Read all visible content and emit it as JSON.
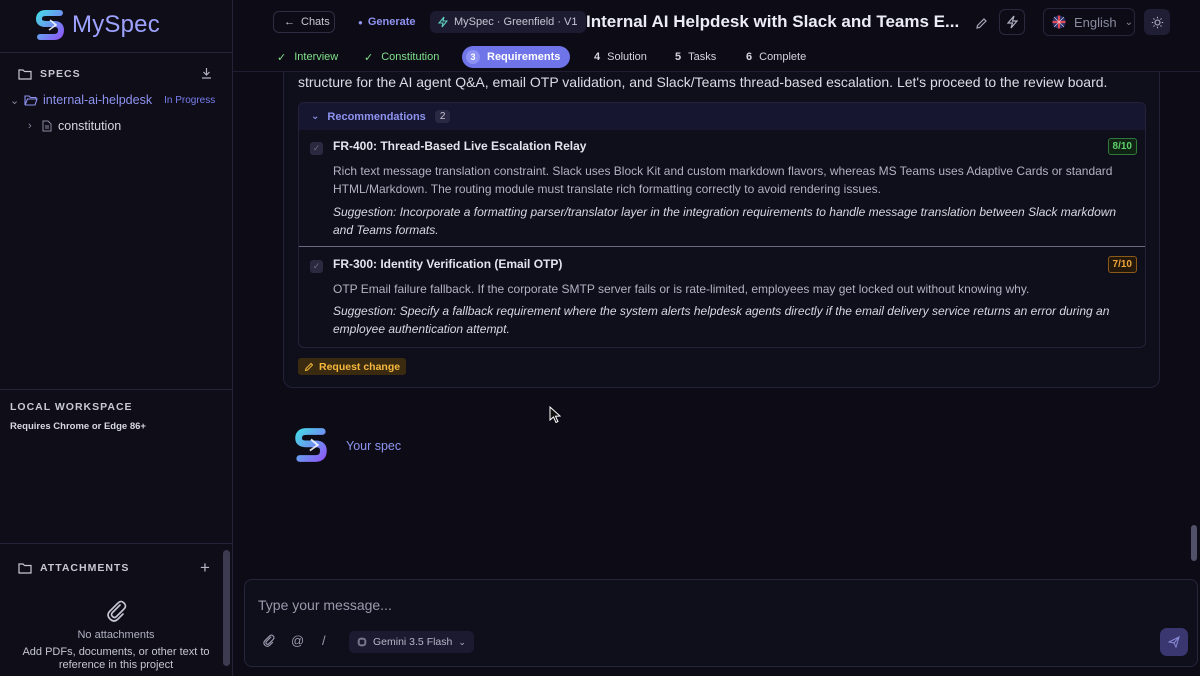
{
  "app": {
    "name": "MySpec"
  },
  "sidebar": {
    "specs_title": "SPECS",
    "tree": [
      {
        "label": "internal-ai-helpdesk",
        "status": "In Progress"
      },
      {
        "label": "constitution"
      }
    ],
    "workspace_title": "LOCAL WORKSPACE",
    "workspace_note": "Requires Chrome or Edge 86+",
    "attachments_title": "ATTACHMENTS",
    "attachments_empty": "No attachments",
    "attachments_hint": "Add PDFs, documents, or other text to reference in this project"
  },
  "header": {
    "back_label": "Chats",
    "generate_label": "Generate",
    "project_badge": "MySpec · Greenfield · V1",
    "title": "Internal AI Helpdesk with Slack and Teams E...",
    "language": "English"
  },
  "steps": [
    {
      "label": "Interview",
      "state": "done"
    },
    {
      "label": "Constitution",
      "state": "done"
    },
    {
      "num": "3",
      "label": "Requirements",
      "state": "active"
    },
    {
      "num": "4",
      "label": "Solution",
      "state": "todo"
    },
    {
      "num": "5",
      "label": "Tasks",
      "state": "todo"
    },
    {
      "num": "6",
      "label": "Complete",
      "state": "todo"
    }
  ],
  "message": {
    "intro": "structure for the AI agent Q&A, email OTP validation, and Slack/Teams thread-based escalation. Let's proceed to the review board.",
    "recommendations_label": "Recommendations",
    "recommendations_count": "2",
    "recommendations": [
      {
        "title": "FR-400: Thread-Based Live Escalation Relay",
        "score": "8/10",
        "description": "Rich text message translation constraint. Slack uses Block Kit and custom markdown flavors, whereas MS Teams uses Adaptive Cards or standard HTML/Markdown. The routing module must translate rich formatting correctly to avoid rendering issues.",
        "suggestion": "Suggestion: Incorporate a formatting parser/translator layer in the integration requirements to handle message translation between Slack markdown and Teams formats."
      },
      {
        "title": "FR-300: Identity Verification (Email OTP)",
        "score": "7/10",
        "description": "OTP Email failure fallback. If the corporate SMTP server fails or is rate-limited, employees may get locked out without knowing why.",
        "suggestion": "Suggestion: Specify a fallback requirement where the system alerts helpdesk agents directly if the email delivery service returns an error during an employee authentication attempt."
      }
    ],
    "request_change_label": "Request change"
  },
  "assistant_label": "Your spec",
  "composer": {
    "placeholder": "Type your message...",
    "model": "Gemini 3.5 Flash",
    "mention_symbol": "@",
    "command_symbol": "/"
  },
  "colors": {
    "accent": "#8e93f0",
    "active_step": "#6f74e8",
    "done": "#7fe08a",
    "score_green": "#5ed16a",
    "score_orange": "#f0a53a",
    "status_in_progress": "#7a7ff0"
  },
  "icons": {
    "logo": "myspec-logo-icon",
    "specs": "folder-icon",
    "download": "download-icon",
    "project": "folder-open-icon",
    "file": "file-icon",
    "attachments": "folder-icon",
    "add": "plus-icon",
    "empty_attachments": "paperclip-icon",
    "edit": "pencil-icon",
    "bolt": "bolt-icon",
    "theme": "sun-icon",
    "send": "send-icon"
  }
}
